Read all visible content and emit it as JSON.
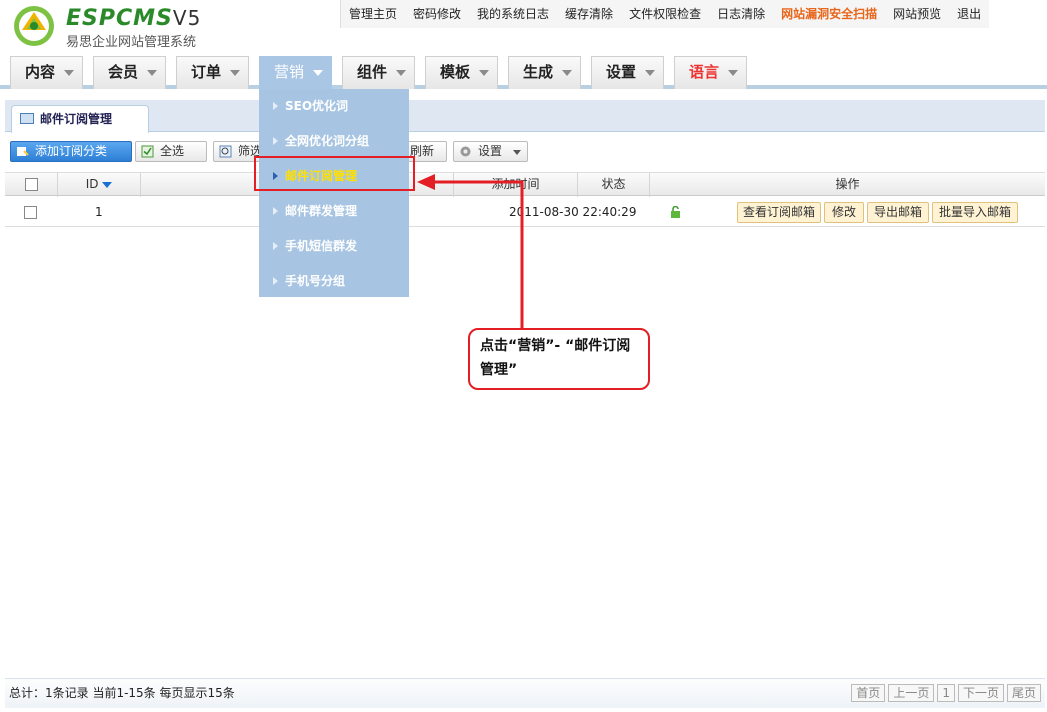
{
  "logo": {
    "brand": "ESPCMS",
    "version": "V5",
    "subtitle": "易思企业网站管理系统"
  },
  "topnav": [
    {
      "label": "管理主页",
      "warn": false
    },
    {
      "label": "密码修改",
      "warn": false
    },
    {
      "label": "我的系统日志",
      "warn": false
    },
    {
      "label": "缓存清除",
      "warn": false
    },
    {
      "label": "文件权限检查",
      "warn": false
    },
    {
      "label": "日志清除",
      "warn": false
    },
    {
      "label": "网站漏洞安全扫描",
      "warn": true
    },
    {
      "label": "网站预览",
      "warn": false
    },
    {
      "label": "退出",
      "warn": false
    }
  ],
  "mainnav": [
    {
      "label": "内容"
    },
    {
      "label": "会员"
    },
    {
      "label": "订单"
    },
    {
      "label": "营销",
      "active": true
    },
    {
      "label": "组件"
    },
    {
      "label": "模板"
    },
    {
      "label": "生成"
    },
    {
      "label": "设置"
    },
    {
      "label": "语言",
      "red": true
    }
  ],
  "dropdown": [
    {
      "label": "SEO优化词"
    },
    {
      "label": "全网优化词分组"
    },
    {
      "label": "邮件订阅管理",
      "selected": true
    },
    {
      "label": "邮件群发管理"
    },
    {
      "label": "手机短信群发"
    },
    {
      "label": "手机号分组"
    }
  ],
  "subtab": {
    "label": "邮件订阅管理"
  },
  "toolbar": {
    "add": "添加订阅分类",
    "select_all": "全选",
    "filter": "筛选",
    "refresh": "刷新",
    "settings": "设置"
  },
  "grid": {
    "headers": {
      "id": "ID",
      "added": "添加时间",
      "status": "状态",
      "ops": "操作"
    },
    "rows": [
      {
        "id": "1",
        "added": "2011-08-30 22:40:29",
        "status_icon": "unlock-icon",
        "ops": [
          "查看订阅邮箱",
          "修改",
          "导出邮箱",
          "批量导入邮箱"
        ]
      }
    ]
  },
  "callout": {
    "text": "点击“营销”- “邮件订阅管理”"
  },
  "footer": {
    "info": "总计：1条记录 当前1-15条 每页显示15条",
    "pager": [
      "首页",
      "上一页",
      "1",
      "下一页",
      "尾页"
    ]
  },
  "colors": {
    "accent": "#a7c5e2",
    "highlight": "#e31e24",
    "warn": "#e8661b"
  }
}
